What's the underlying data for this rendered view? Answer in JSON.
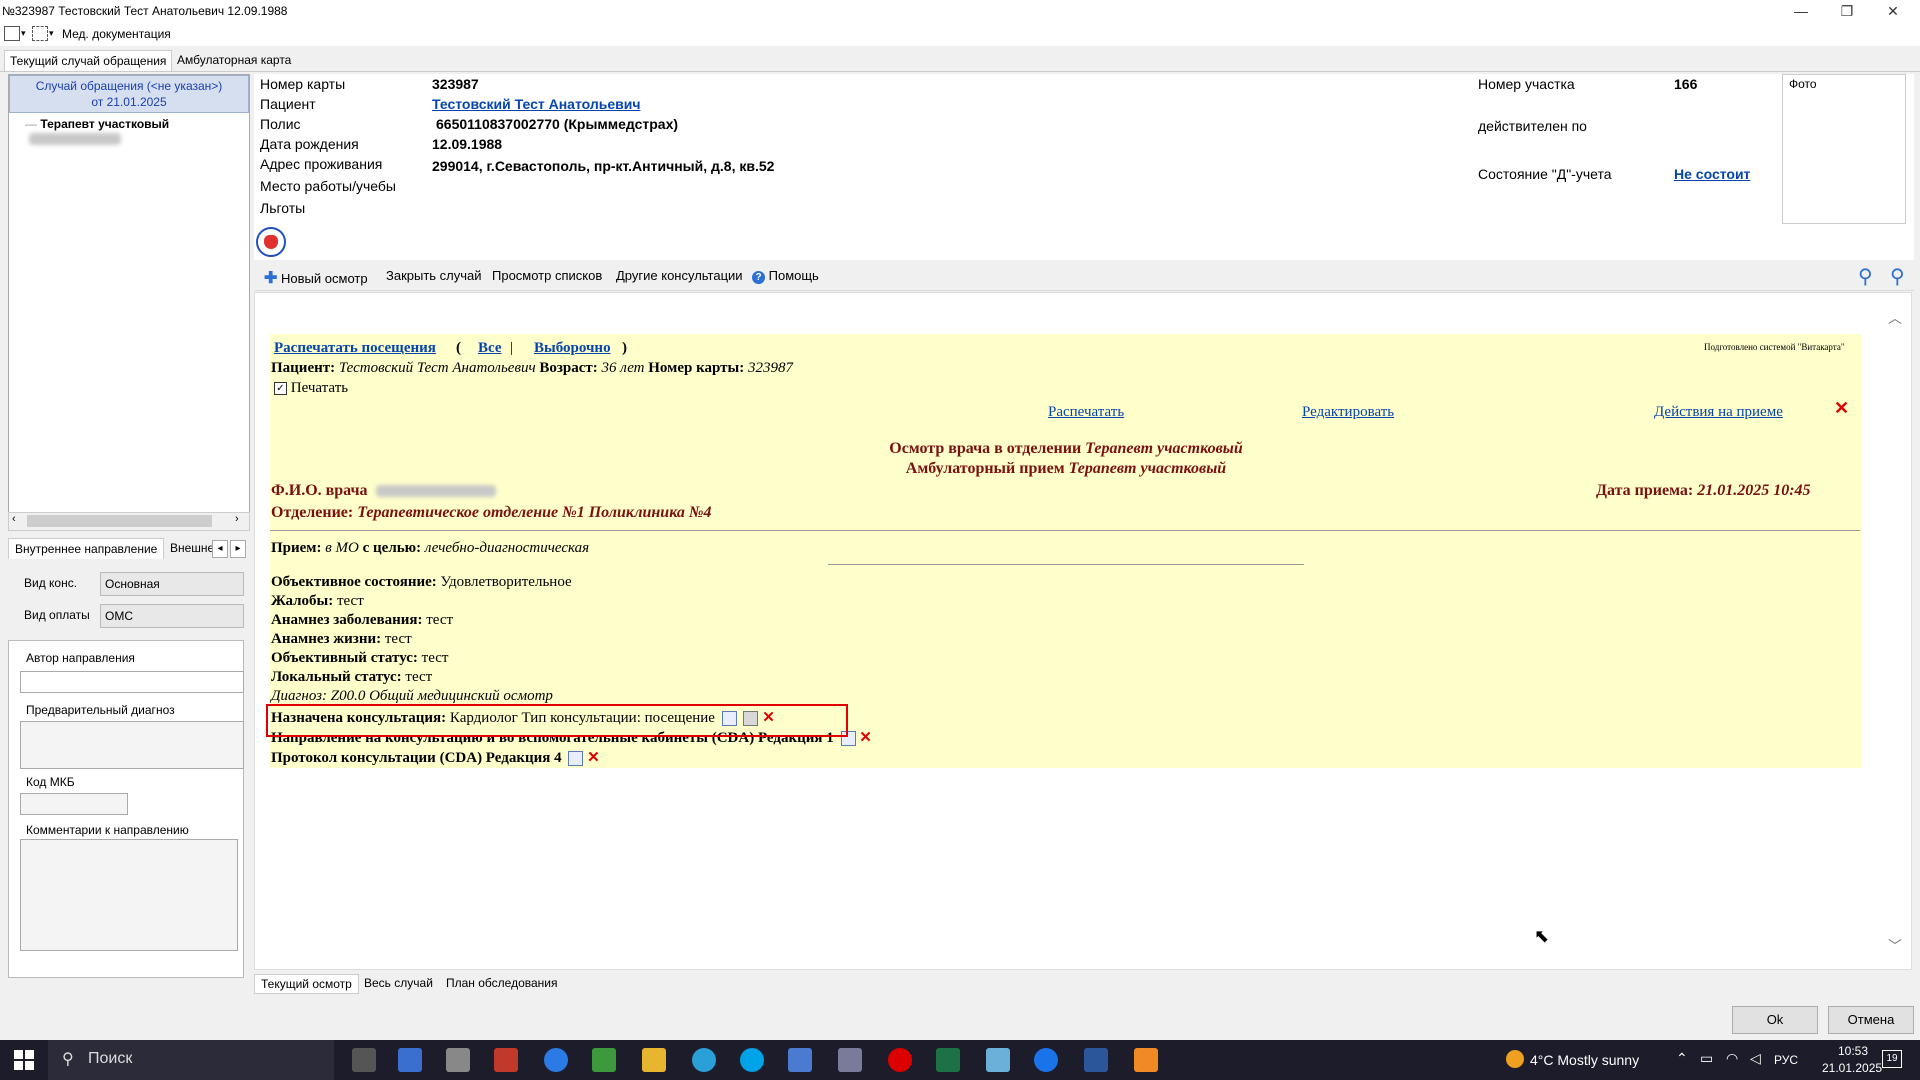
{
  "window": {
    "title": "№323987 Тестовский Тест Анатольевич 12.09.1988",
    "minimize": "—",
    "restore": "❐",
    "close": "✕"
  },
  "menubar": {
    "med_docs": "Мед. документация"
  },
  "tabs": {
    "current_case": "Текущий случай обращения",
    "outpatient_card": "Амбулаторная карта"
  },
  "left": {
    "case_line1": "Случай обращения (<не указан>)",
    "case_line2": "от 21.01.2025",
    "tree_item": "Терапевт участковый"
  },
  "lower_left": {
    "tab_internal": "Внутреннее направление",
    "tab_external": "Внешне",
    "vid_kons_label": "Вид конс.",
    "vid_kons_value": "Основная",
    "vid_oplaty_label": "Вид оплаты",
    "vid_oplaty_value": "ОМС",
    "author_label": "Автор направления",
    "prelim_diag_label": "Предварительный диагноз",
    "mkb_label": "Код МКБ",
    "comments_label": "Комментарии к направлению"
  },
  "patient": {
    "card_no_label": "Номер карты",
    "card_no": "323987",
    "patient_label": "Пациент",
    "patient_name": "Тестовский Тест Анатольевич",
    "policy_label": "Полис",
    "policy": "6650110837002770 (Крыммедстрах)",
    "dob_label": "Дата рождения",
    "dob": "12.09.1988",
    "address_label": "Адрес проживания",
    "address": "299014, г.Севастополь, пр-кт.Античный, д.8, кв.52",
    "work_label": "Место работы/учебы",
    "benefits_label": "Льготы",
    "district_label": "Номер участка",
    "district": "166",
    "valid_label": "действителен по",
    "d_status_label": "Состояние \"Д\"-учета",
    "d_status": "Не состоит",
    "photo_label": "Фото"
  },
  "toolbar": {
    "new_exam": "Новый осмотр",
    "close_case": "Закрыть случай",
    "view_lists": "Просмотр списков",
    "other_consult": "Другие консультации",
    "help": "Помощь"
  },
  "doc": {
    "print_visits": "Распечатать посещения",
    "all": "Все",
    "selective": "Выборочно",
    "prepared_by": "Подготовлено системой \"Витакарта\"",
    "patient_label": "Пациент:",
    "patient_name": "Тестовский Тест Анатольевич",
    "age_label": "Возраст:",
    "age": "36 лет",
    "card_label": "Номер карты:",
    "card": "323987",
    "print_checkbox": "Печатать",
    "print": "Распечатать",
    "edit": "Редактировать",
    "actions": "Действия на приеме",
    "header1_a": "Осмотр врача в отделении",
    "header1_b": "Терапевт участковый",
    "header2_a": "Амбулаторный прием",
    "header2_b": "Терапевт участковый",
    "doctor_label": "Ф.И.О. врача",
    "date_label": "Дата приема:",
    "date": "21.01.2025 10:45",
    "dept_label": "Отделение:",
    "dept": "Терапевтическое отделение №1 Поликлиника №4",
    "reception_label": "Прием:",
    "reception_a": "в МО",
    "reception_goal_label": "с целью:",
    "reception_goal": "лечебно-диагностическая",
    "lines": [
      {
        "label": "Объективное состояние:",
        "value": "Удовлетворительное"
      },
      {
        "label": "Жалобы:",
        "value": "тест"
      },
      {
        "label": "Анамнез заболевания:",
        "value": "тест"
      },
      {
        "label": "Анамнез жизни:",
        "value": "тест"
      },
      {
        "label": "Объективный статус:",
        "value": "тест"
      },
      {
        "label": "Локальный статус:",
        "value": "тест"
      }
    ],
    "diagnosis": "Диагноз: Z00.0 Общий медицинский осмотр",
    "consult_label": "Назначена консультация:",
    "consult_value": "Кардиолог Тип консультации: посещение",
    "referral": "Направление на консультацию и во вспомогательные кабинеты (CDA) Редакция 1",
    "protocol": "Протокол консультации (CDA) Редакция 4"
  },
  "bottom_tabs": {
    "current_exam": "Текущий осмотр",
    "whole_case": "Весь случай",
    "exam_plan": "План обследования"
  },
  "buttons": {
    "ok": "Ok",
    "cancel": "Отмена"
  },
  "taskbar": {
    "search": "Поиск",
    "weather": "4°C  Mostly sunny",
    "lang": "РУС",
    "time": "10:53",
    "date": "21.01.2025",
    "notif_count": "19"
  },
  "colors": {
    "doc_bg": "#ffffcc",
    "link": "#0645ad",
    "dark_red": "#7a1010",
    "highlight": "#e00000"
  }
}
